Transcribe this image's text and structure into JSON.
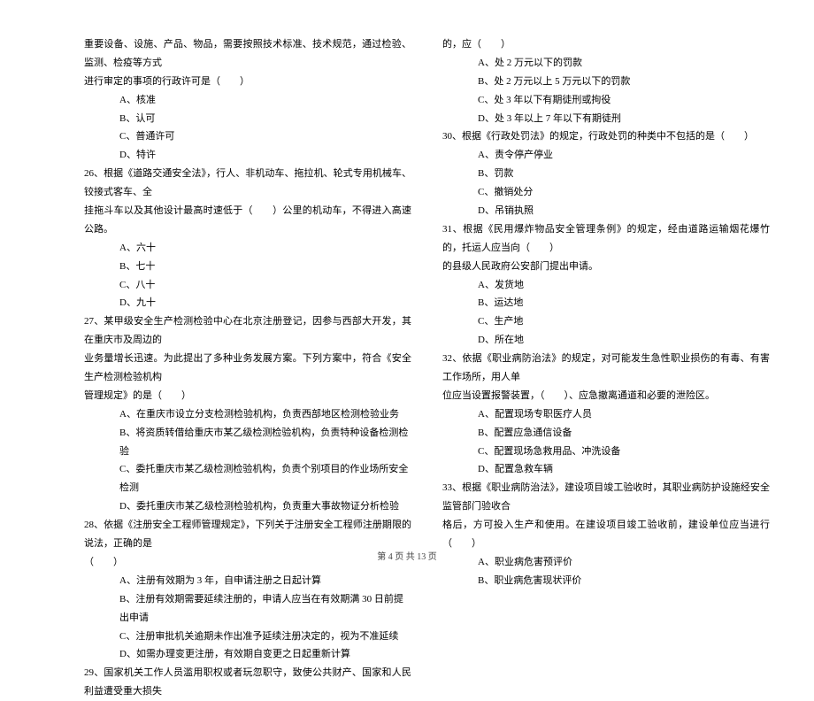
{
  "left_column": {
    "intro_line1": "重要设备、设施、产品、物品，需要按照技术标准、技术规范，通过检验、监测、检疫等方式",
    "intro_line2": "进行审定的事项的行政许可是（　　）",
    "intro_options": {
      "a": "A、核准",
      "b": "B、认可",
      "c": "C、普通许可",
      "d": "D、特许"
    },
    "q26_line1": "26、根据《道路交通安全法》，行人、非机动车、拖拉机、轮式专用机械车、铰接式客车、全",
    "q26_line2": "挂拖斗车以及其他设计最高时速低于（　　）公里的机动车，不得进入高速公路。",
    "q26_options": {
      "a": "A、六十",
      "b": "B、七十",
      "c": "C、八十",
      "d": "D、九十"
    },
    "q27_line1": "27、某甲级安全生产检测检验中心在北京注册登记，因参与西部大开发，其在重庆市及周边的",
    "q27_line2": "业务量增长迅速。为此提出了多种业务发展方案。下列方案中，符合《安全生产检测检验机构",
    "q27_line3": "管理规定》的是（　　）",
    "q27_options": {
      "a": "A、在重庆市设立分支检测检验机构，负责西部地区检测检验业务",
      "b": "B、将资质转借给重庆市某乙级检测检验机构，负责特种设备检测检验",
      "c": "C、委托重庆市某乙级检测检验机构，负责个别项目的作业场所安全检测",
      "d": "D、委托重庆市某乙级检测检验机构，负责重大事故物证分析检验"
    },
    "q28_line1": "28、依据《注册安全工程师管理规定》，下列关于注册安全工程师注册期限的说法，正确的是",
    "q28_line2": "（　　）",
    "q28_options": {
      "a": "A、注册有效期为 3 年，自申请注册之日起计算",
      "b": "B、注册有效期需要延续注册的，申请人应当在有效期满 30 日前提出申请",
      "c": "C、注册审批机关逾期未作出准予延续注册决定的，视为不准延续",
      "d": "D、如需办理变更注册，有效期自变更之日起重新计算"
    },
    "q29_line1": "29、国家机关工作人员滥用职权或者玩忽职守，致使公共财产、国家和人民利益遭受重大损失"
  },
  "right_column": {
    "q29_cont": "的，应（　　）",
    "q29_options": {
      "a": "A、处 2 万元以下的罚款",
      "b": "B、处 2 万元以上 5 万元以下的罚款",
      "c": "C、处 3 年以下有期徒刑或拘役",
      "d": "D、处 3 年以上 7 年以下有期徒刑"
    },
    "q30_line1": "30、根据《行政处罚法》的规定，行政处罚的种类中不包括的是（　　）",
    "q30_options": {
      "a": "A、责令停产停业",
      "b": "B、罚款",
      "c": "C、撤销处分",
      "d": "D、吊销执照"
    },
    "q31_line1": "31、根据《民用爆炸物品安全管理条例》的规定，经由道路运输烟花爆竹的，托运人应当向（　　）",
    "q31_line2": "的县级人民政府公安部门提出申请。",
    "q31_options": {
      "a": "A、发货地",
      "b": "B、运达地",
      "c": "C、生产地",
      "d": "D、所在地"
    },
    "q32_line1": "32、依据《职业病防治法》的规定，对可能发生急性职业损伤的有毒、有害工作场所，用人单",
    "q32_line2": "位应当设置报警装置，（　　）、应急撤离通道和必要的泄险区。",
    "q32_options": {
      "a": "A、配置现场专职医疗人员",
      "b": "B、配置应急通信设备",
      "c": "C、配置现场急救用品、冲洗设备",
      "d": "D、配置急救车辆"
    },
    "q33_line1": "33、根据《职业病防治法》，建设项目竣工验收时，其职业病防护设施经安全监管部门验收合",
    "q33_line2": "格后，方可投入生产和使用。在建设项目竣工验收前，建设单位应当进行（　　）",
    "q33_options": {
      "a": "A、职业病危害预评价",
      "b": "B、职业病危害现状评价"
    }
  },
  "footer": "第 4 页 共 13 页"
}
